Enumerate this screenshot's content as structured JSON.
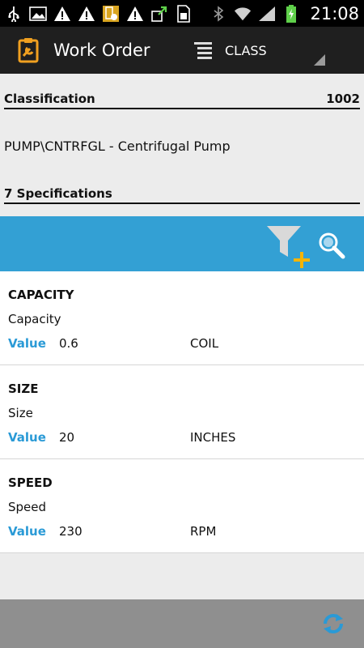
{
  "status_bar": {
    "time": "21:08",
    "icons": [
      "usb-icon",
      "image-icon",
      "warning-icon",
      "warning-icon",
      "phone-settings-icon",
      "warning-icon",
      "upload-icon",
      "sim-icon",
      "bluetooth-icon",
      "wifi-icon",
      "signal-icon",
      "battery-charging-icon"
    ]
  },
  "action_bar": {
    "title": "Work Order",
    "class_label": "CLASS"
  },
  "classification": {
    "label": "Classification",
    "number": "1002",
    "description": "PUMP\\CNTRFGL - Centrifugal Pump",
    "specs_label": "7 Specifications"
  },
  "list": {
    "items": [
      {
        "name": "CAPACITY",
        "description": "Capacity",
        "value_label": "Value",
        "value": "0.6",
        "unit": "COIL"
      },
      {
        "name": "SIZE",
        "description": "Size",
        "value_label": "Value",
        "value": "20",
        "unit": "INCHES"
      },
      {
        "name": "SPEED",
        "description": "Speed",
        "value_label": "Value",
        "value": "230",
        "unit": "RPM"
      }
    ]
  },
  "colors": {
    "toolbar": "#33a0d4",
    "value_label": "#2a9ad6",
    "filter_plus": "#f5b400",
    "app_icon": "#f0a020"
  }
}
